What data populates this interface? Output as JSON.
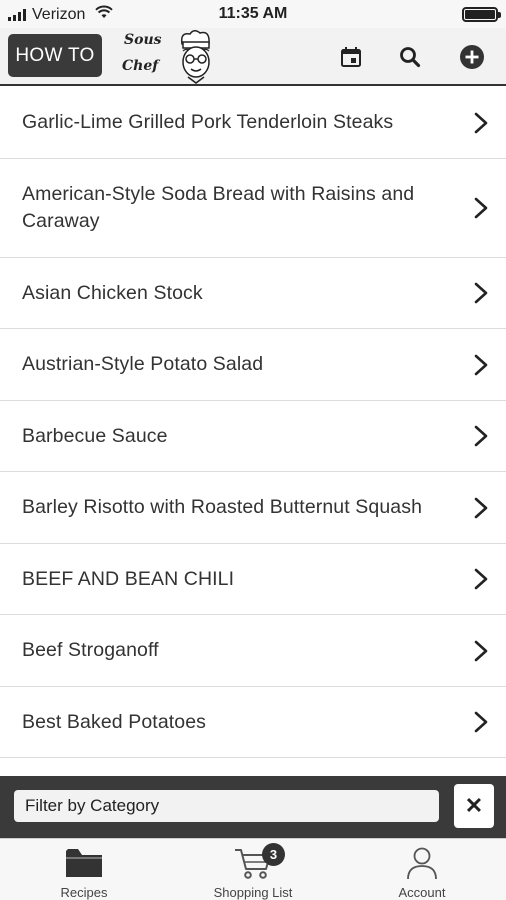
{
  "status_bar": {
    "carrier": "Verizon",
    "time": "11:35 AM"
  },
  "header": {
    "how_to_label": "HOW TO",
    "logo_line1": "Sous",
    "logo_line2": "Chef",
    "icons": [
      "calendar-icon",
      "search-icon",
      "add-circle-icon"
    ]
  },
  "recipes": [
    "Garlic-Lime Grilled Pork Tenderloin Steaks",
    "American-Style Soda Bread with Raisins and Caraway",
    "Asian Chicken Stock",
    "Austrian-Style Potato Salad",
    "Barbecue Sauce",
    "Barley Risotto with Roasted Butternut Squash",
    "BEEF AND BEAN CHILI",
    "Beef Stroganoff",
    "Best Baked Potatoes",
    ""
  ],
  "filter": {
    "placeholder": "Filter by Category",
    "clear_label": "✕"
  },
  "tabs": {
    "recipes": "Recipes",
    "shopping_list": "Shopping List",
    "shopping_badge": "3",
    "account": "Account"
  }
}
